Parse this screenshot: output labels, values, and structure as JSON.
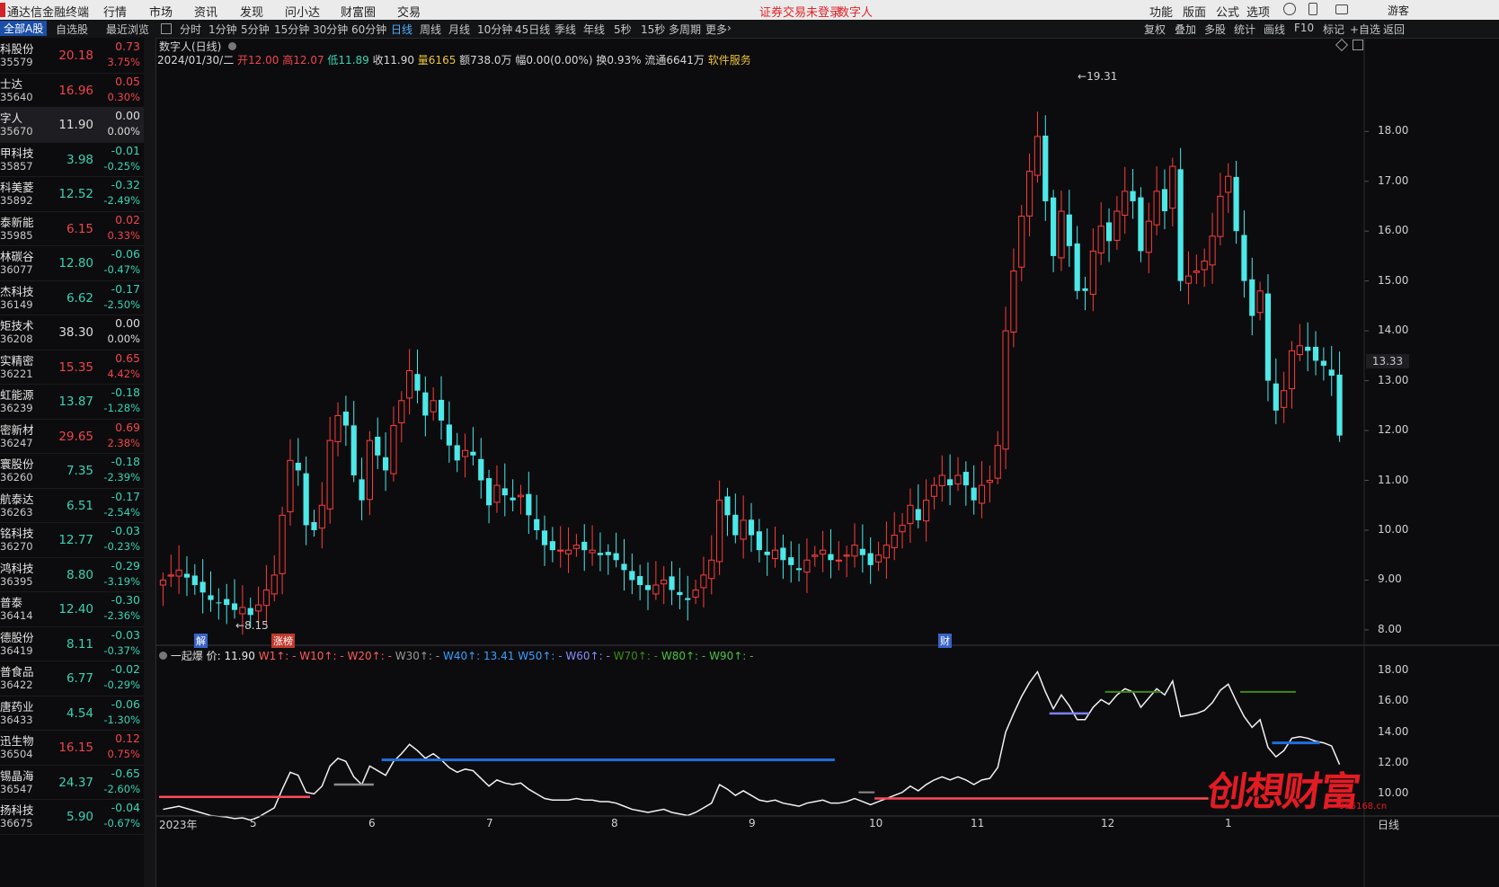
{
  "menu": {
    "app_title": "通达信金融终端",
    "items": [
      "行情",
      "市场",
      "资讯",
      "发现",
      "问小达",
      "财富圈",
      "交易"
    ],
    "warning": "证券交易未登录",
    "stock_name": "数字人",
    "right_items": [
      "功能",
      "版面",
      "公式",
      "选项"
    ]
  },
  "toolbar": {
    "list_tabs": [
      "全部A股",
      "自选股",
      "最近浏览"
    ],
    "periods": [
      "分时",
      "1分钟",
      "5分钟",
      "15分钟",
      "30分钟",
      "60分钟",
      "日线",
      "周线",
      "月线",
      "10分钟",
      "45日线",
      "季线",
      "年线",
      "5秒",
      "15秒",
      "多周期",
      "更多"
    ],
    "selected_period": "日线",
    "right_buttons": [
      "复权",
      "叠加",
      "多股",
      "统计",
      "画线",
      "F10",
      "标记",
      "+自选",
      "返回"
    ]
  },
  "watchlist": [
    {
      "name": "科股份",
      "code": "35579",
      "price": "20.18",
      "change": "0.73",
      "pct": "3.75%",
      "dir": "up"
    },
    {
      "name": "士达",
      "code": "35640",
      "price": "16.96",
      "change": "0.05",
      "pct": "0.30%",
      "dir": "up"
    },
    {
      "name": "字人",
      "code": "35670",
      "price": "11.90",
      "change": "0.00",
      "pct": "0.00%",
      "dir": "fl"
    },
    {
      "name": "甲科技",
      "code": "35857",
      "price": "3.98",
      "change": "-0.01",
      "pct": "-0.25%",
      "dir": "dn"
    },
    {
      "name": "科美菱",
      "code": "35892",
      "price": "12.52",
      "change": "-0.32",
      "pct": "-2.49%",
      "dir": "dn"
    },
    {
      "name": "泰新能",
      "code": "35985",
      "price": "6.15",
      "change": "0.02",
      "pct": "0.33%",
      "dir": "up"
    },
    {
      "name": "林碳谷",
      "code": "36077",
      "price": "12.80",
      "change": "-0.06",
      "pct": "-0.47%",
      "dir": "dn"
    },
    {
      "name": "杰科技",
      "code": "36149",
      "price": "6.62",
      "change": "-0.17",
      "pct": "-2.50%",
      "dir": "dn"
    },
    {
      "name": "矩技术",
      "code": "36208",
      "price": "38.30",
      "change": "0.00",
      "pct": "0.00%",
      "dir": "fl"
    },
    {
      "name": "实精密",
      "code": "36221",
      "price": "15.35",
      "change": "0.65",
      "pct": "4.42%",
      "dir": "up"
    },
    {
      "name": "虹能源",
      "code": "36239",
      "price": "13.87",
      "change": "-0.18",
      "pct": "-1.28%",
      "dir": "dn"
    },
    {
      "name": "密新材",
      "code": "36247",
      "price": "29.65",
      "change": "0.69",
      "pct": "2.38%",
      "dir": "up"
    },
    {
      "name": "寰股份",
      "code": "36260",
      "price": "7.35",
      "change": "-0.18",
      "pct": "-2.39%",
      "dir": "dn"
    },
    {
      "name": "航泰达",
      "code": "36263",
      "price": "6.51",
      "change": "-0.17",
      "pct": "-2.54%",
      "dir": "dn"
    },
    {
      "name": "铭科技",
      "code": "36270",
      "price": "12.77",
      "change": "-0.03",
      "pct": "-0.23%",
      "dir": "dn"
    },
    {
      "name": "鸿科技",
      "code": "36395",
      "price": "8.80",
      "change": "-0.29",
      "pct": "-3.19%",
      "dir": "dn"
    },
    {
      "name": "普泰",
      "code": "36414",
      "price": "12.40",
      "change": "-0.30",
      "pct": "-2.36%",
      "dir": "dn"
    },
    {
      "name": "德股份",
      "code": "36419",
      "price": "8.11",
      "change": "-0.03",
      "pct": "-0.37%",
      "dir": "dn"
    },
    {
      "name": "普食品",
      "code": "36422",
      "price": "6.77",
      "change": "-0.02",
      "pct": "-0.29%",
      "dir": "dn"
    },
    {
      "name": "唐药业",
      "code": "36433",
      "price": "4.54",
      "change": "-0.06",
      "pct": "-1.30%",
      "dir": "dn"
    },
    {
      "name": "迅生物",
      "code": "36504",
      "price": "16.15",
      "change": "0.12",
      "pct": "0.75%",
      "dir": "up"
    },
    {
      "name": "锡晶海",
      "code": "36547",
      "price": "24.37",
      "change": "-0.65",
      "pct": "-2.60%",
      "dir": "dn"
    },
    {
      "name": "扬科技",
      "code": "36675",
      "price": "5.90",
      "change": "-0.04",
      "pct": "-0.67%",
      "dir": "dn"
    }
  ],
  "chart": {
    "title": "数字人(日线)",
    "date": "2024/01/30/二",
    "open": "开12.00",
    "high": "高12.07",
    "low": "低11.89",
    "close": "收11.90",
    "vol": "量6165",
    "amount": "额738.0万",
    "amp": "幅0.00(0.00%)",
    "turnover": "换0.93%",
    "float": "流通6641万",
    "industry": "软件服务",
    "current_price_tag": "13.33",
    "high_marker": "19.31",
    "low_marker": "8.15",
    "markers": [
      "解",
      "涨榜",
      "财"
    ],
    "indicator": {
      "name": "一起爆",
      "price_label": "价: 11.90",
      "w1": "W1↑: -",
      "w10": "W10↑: -",
      "w20": "W20↑: -",
      "w30": "W30↑: -",
      "w40": "W40↑: 13.41",
      "w50": "W50↑: -",
      "w60": "W60↑: -",
      "w70": "W70↑: -",
      "w80": "W80↑: -",
      "w90": "W90↑: -"
    },
    "colors": {
      "up": "#ff3c3c",
      "down": "#4de8e8",
      "w40": "#1f6fdc",
      "w10": "#ff4a5a",
      "w60": "#8080ff",
      "w70": "#3e8a18",
      "w30": "#8c8c8c"
    },
    "footer": {
      "period": "日线"
    },
    "logo": {
      "text": "创想财富",
      "url": "995168.cn"
    }
  },
  "chart_data": {
    "type": "candlestick",
    "y_ticks": [
      "18.00",
      "17.00",
      "16.00",
      "15.00",
      "14.00",
      "13.00",
      "12.00",
      "11.00",
      "10.00",
      "9.00",
      "8.00"
    ],
    "ylim": [
      7.8,
      19.7
    ],
    "sub_y_ticks": [
      "18.00",
      "16.00",
      "14.00",
      "12.00",
      "10.00"
    ],
    "x_ticks": [
      "2023年",
      "5",
      "6",
      "7",
      "8",
      "9",
      "10",
      "11",
      "12",
      "1"
    ],
    "closes": [
      9.0,
      9.1,
      9.2,
      9.05,
      8.9,
      8.75,
      8.6,
      8.55,
      8.5,
      8.4,
      8.45,
      8.3,
      8.5,
      8.8,
      9.1,
      10.3,
      11.4,
      11.2,
      10.1,
      10.0,
      10.5,
      11.8,
      12.3,
      12.1,
      11.1,
      10.6,
      11.8,
      11.5,
      11.2,
      12.1,
      12.6,
      13.2,
      12.8,
      12.3,
      12.6,
      12.2,
      11.7,
      11.4,
      11.6,
      11.5,
      11.0,
      10.5,
      10.9,
      10.7,
      10.6,
      10.7,
      10.3,
      10.0,
      9.7,
      9.6,
      9.6,
      9.6,
      9.7,
      9.6,
      9.6,
      9.5,
      9.5,
      9.4,
      9.2,
      9.0,
      8.9,
      8.8,
      8.9,
      9.0,
      8.8,
      8.7,
      8.6,
      8.8,
      9.1,
      9.4,
      10.6,
      10.3,
      9.9,
      10.2,
      9.9,
      9.6,
      9.5,
      9.6,
      9.4,
      9.3,
      9.2,
      9.4,
      9.5,
      9.6,
      9.4,
      9.4,
      9.5,
      9.7,
      9.5,
      9.3,
      9.5,
      9.7,
      9.9,
      10.1,
      10.5,
      10.2,
      10.6,
      10.9,
      11.1,
      10.9,
      11.1,
      10.9,
      10.6,
      10.9,
      11.0,
      11.7,
      14.0,
      15.2,
      16.3,
      17.2,
      17.9,
      16.6,
      15.5,
      16.4,
      15.7,
      14.8,
      14.8,
      15.6,
      16.1,
      15.8,
      16.4,
      16.8,
      16.6,
      15.6,
      16.2,
      16.8,
      16.4,
      17.3,
      15.0,
      15.1,
      15.2,
      15.4,
      15.9,
      16.7,
      17.1,
      16.0,
      15.0,
      14.3,
      14.8,
      13.0,
      12.4,
      12.8,
      13.6,
      13.7,
      13.6,
      13.4,
      13.3,
      13.1,
      11.9
    ]
  }
}
